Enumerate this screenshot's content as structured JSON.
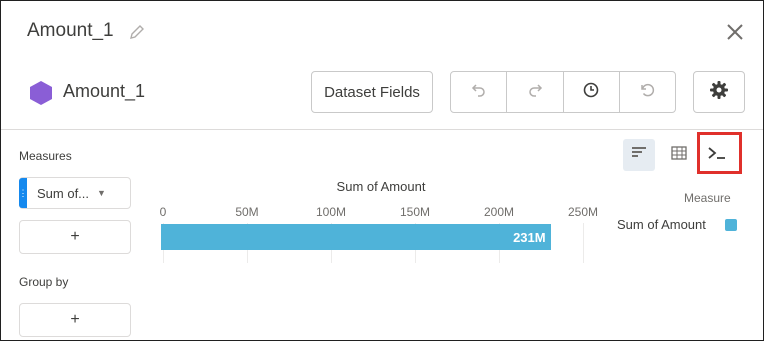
{
  "window": {
    "title": "Amount_1"
  },
  "header": {
    "dataset_name": "Amount_1",
    "dataset_fields_label": "Dataset Fields"
  },
  "left_panel": {
    "measures_label": "Measures",
    "measure_pill": "Sum of...",
    "add_symbol": "+",
    "group_by_label": "Group by"
  },
  "toolbar_icons": [
    "undo-icon",
    "redo-icon",
    "history-icon",
    "reset-icon",
    "gear-icon"
  ],
  "view_toggles": [
    "bar-chart-icon",
    "table-icon",
    "formula-icon"
  ],
  "colors": {
    "bar": "#4fb3d9",
    "accent": "#1589ee",
    "highlight": "#e0302b",
    "brand_hex": "#8a5ed6"
  },
  "chart_data": {
    "type": "bar",
    "title": "Sum of Amount",
    "orientation": "horizontal",
    "categories": [
      ""
    ],
    "series": [
      {
        "name": "Sum of Amount",
        "values": [
          231
        ]
      }
    ],
    "value_label": "231M",
    "ticks": [
      "0",
      "50M",
      "100M",
      "150M",
      "200M",
      "250M"
    ],
    "xlim": [
      0,
      250
    ],
    "legend": {
      "title": "Measure",
      "items": [
        "Sum of Amount"
      ],
      "position": "right"
    }
  }
}
